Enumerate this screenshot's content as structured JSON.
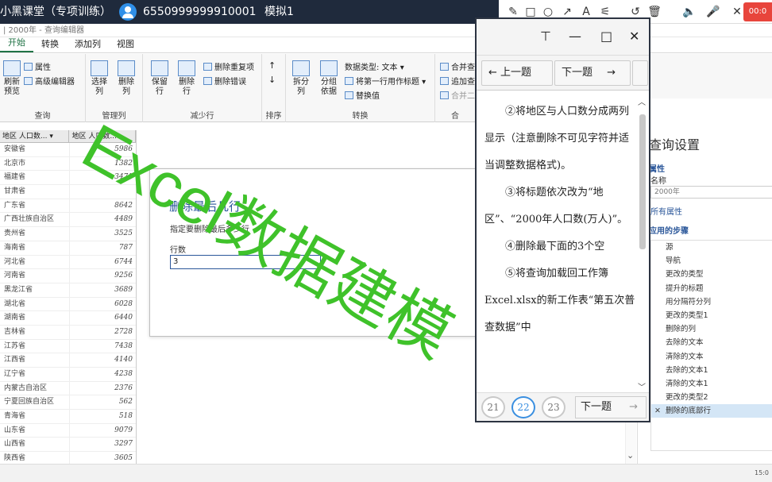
{
  "topbar": {
    "title": "小黑课堂（专项训练）",
    "user_id": "6550999999910001",
    "mode": "模拟1",
    "record_time": "00:0"
  },
  "drawtools": {
    "icons": [
      "pen-icon",
      "rectangle-icon",
      "circle-icon",
      "arrow-icon",
      "text-icon",
      "highlighter-icon",
      "undo-icon",
      "delete-icon",
      "speaker-icon",
      "mic-icon",
      "close-icon"
    ]
  },
  "editor": {
    "window_title": "| 2000年 - 查询编辑器",
    "menus": [
      "开始",
      "转换",
      "添加列",
      "视图"
    ],
    "ribbon": {
      "query_group": {
        "name": "查询",
        "refresh": "刷新\n预览",
        "properties": "属性",
        "advanced": "高级编辑器"
      },
      "manage_group": {
        "name": "管理列",
        "choose": "选择\n列",
        "remove": "删除\n列"
      },
      "reduce_group": {
        "name": "减少行",
        "keep": "保留\n行",
        "remove": "删除\n行",
        "remove_dup": "删除重复项",
        "remove_err": "删除错误"
      },
      "sort_group": {
        "name": "排序"
      },
      "transform_group": {
        "name": "转换",
        "split": "拆分\n列",
        "group": "分组\n依据",
        "datatype": "数据类型: 文本",
        "first_row": "将第一行用作标题",
        "replace": "替换值"
      },
      "combine_group": {
        "name": "合",
        "merge": "合并查",
        "append": "追加查",
        "combine2": "合并二"
      }
    }
  },
  "grid": {
    "headers": [
      "地区 人口数...",
      "地区 人口数..."
    ],
    "rows": [
      [
        "安徽省",
        "5986"
      ],
      [
        "北京市",
        "1382"
      ],
      [
        "福建省",
        "3471"
      ],
      [
        "甘肃省",
        ""
      ],
      [
        "广东省",
        "8642"
      ],
      [
        "广西壮族自治区",
        "4489"
      ],
      [
        "贵州省",
        "3525"
      ],
      [
        "海南省",
        "787"
      ],
      [
        "河北省",
        "6744"
      ],
      [
        "河南省",
        "9256"
      ],
      [
        "黑龙江省",
        "3689"
      ],
      [
        "湖北省",
        "6028"
      ],
      [
        "湖南省",
        "6440"
      ],
      [
        "吉林省",
        "2728"
      ],
      [
        "江苏省",
        "7438"
      ],
      [
        "江西省",
        "4140"
      ],
      [
        "辽宁省",
        "4238"
      ],
      [
        "内蒙古自治区",
        "2376"
      ],
      [
        "宁夏回族自治区",
        "562"
      ],
      [
        "青海省",
        "518"
      ],
      [
        "山东省",
        "9079"
      ],
      [
        "山西省",
        "3297"
      ],
      [
        "陕西省",
        "3605"
      ]
    ]
  },
  "dialog": {
    "title": "删除最后几行",
    "description": "指定要删除最后多少行",
    "label": "行数",
    "value": "3"
  },
  "query_settings": {
    "title": "查询设置",
    "properties": "属性",
    "name_label": "名称",
    "name_value": "2000年",
    "all_properties": "所有属性",
    "applied_steps": "应用的步骤",
    "steps": [
      "源",
      "导航",
      "更改的类型",
      "提升的标题",
      "用分隔符分列",
      "更改的类型1",
      "删除的列",
      "去除的文本",
      "清除的文本",
      "去除的文本1",
      "清除的文本1",
      "更改的类型2",
      "删除的底部行"
    ],
    "selected_step": "删除的底部行"
  },
  "status": {
    "time": "15:0"
  },
  "question": {
    "prev": "上一题",
    "next": "下一题",
    "paragraphs": [
      "②将地区与人口数分成两列显示（注意删除不可见字符并适当调整数据格式)。",
      "③将标题依次改为“地区”、“2000年人口数(万人)”。",
      "④删除最下面的3个空",
      "⑤将查询加载回工作簿Excel.xlsx的新工作表“第五次普查数据”中"
    ],
    "pages": [
      "21",
      "22",
      "23"
    ],
    "current_page": "22",
    "next_bottom": "下一题"
  },
  "watermark": {
    "text": "Excel数据建模",
    "color": "#3fc22a"
  }
}
